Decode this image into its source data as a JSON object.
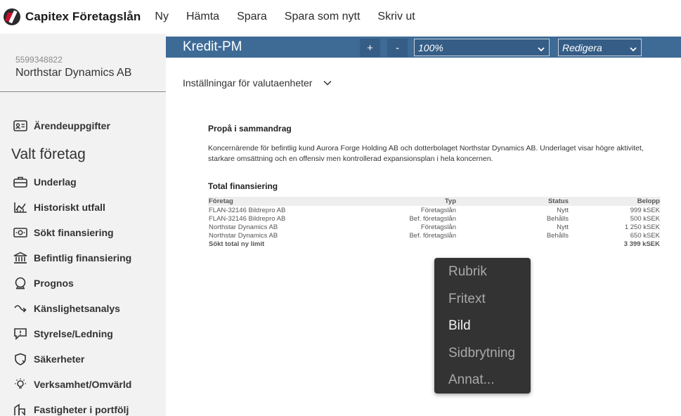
{
  "app": {
    "title": "Capitex Företagslån",
    "menu": [
      "Ny",
      "Hämta",
      "Spara",
      "Spara som nytt",
      "Skriv ut"
    ]
  },
  "company": {
    "orgnr": "5599348822",
    "name": "Northstar Dynamics AB"
  },
  "sidebar": {
    "top_item": "Ärendeuppgifter",
    "heading": "Valt företag",
    "items": [
      {
        "label": "Underlag",
        "icon": "briefcase-icon"
      },
      {
        "label": "Historiskt utfall",
        "icon": "chart-icon"
      },
      {
        "label": "Sökt finansiering",
        "icon": "money-icon"
      },
      {
        "label": "Befintlig finansiering",
        "icon": "bank-icon"
      },
      {
        "label": "Prognos",
        "icon": "crystal-ball-icon"
      },
      {
        "label": "Känslighetsanalys",
        "icon": "arrow-curve-icon"
      },
      {
        "label": "Styrelse/Ledning",
        "icon": "alert-chat-icon"
      },
      {
        "label": "Säkerheter",
        "icon": "shield-icon"
      },
      {
        "label": "Verksamhet/Omvärld",
        "icon": "bulb-icon"
      },
      {
        "label": "Fastigheter i portfölj",
        "icon": "building-icon"
      }
    ]
  },
  "docbar": {
    "title": "Kredit-PM",
    "zoom_in": "+",
    "zoom_out": "-",
    "zoom": "100%",
    "mode": "Redigera"
  },
  "content": {
    "valuta_label": "Inställningar för valutaenheter",
    "propa_heading": "Propå i sammandrag",
    "propa_text": "Koncernärende för befintlig kund Aurora Forge Holding AB och dotterbolaget Northstar Dynamics AB. Underlaget visar högre aktivitet, starkare omsättning och en offensiv men kontrollerad expansionsplan i hela koncernen.",
    "total_heading": "Total finansiering",
    "table": {
      "headers": [
        "Företag",
        "Typ",
        "Status",
        "Belopp"
      ],
      "rows": [
        [
          "FLAN-32146 Bildrepro AB",
          "Företagslån",
          "Nytt",
          "999 kSEK"
        ],
        [
          "FLAN-32146 Bildrepro AB",
          "Bef. företagslån",
          "Behålls",
          "500 kSEK"
        ],
        [
          "Northstar Dynamics AB",
          "Företagslån",
          "Nytt",
          "1 250 kSEK"
        ],
        [
          "Northstar Dynamics AB",
          "Bef. företagslån",
          "Behålls",
          "650 kSEK"
        ]
      ],
      "sum_label": "Sökt total ny limit",
      "sum_value": "3 399 kSEK"
    }
  },
  "context_menu": {
    "items": [
      "Rubrik",
      "Fritext",
      "Bild",
      "Sidbrytning",
      "Annat..."
    ],
    "active": "Bild"
  },
  "colors": {
    "docbar": "#3e6b96",
    "sidebar": "#f2f2f2",
    "context_menu": "#333333",
    "brand_red": "#c8102e"
  }
}
